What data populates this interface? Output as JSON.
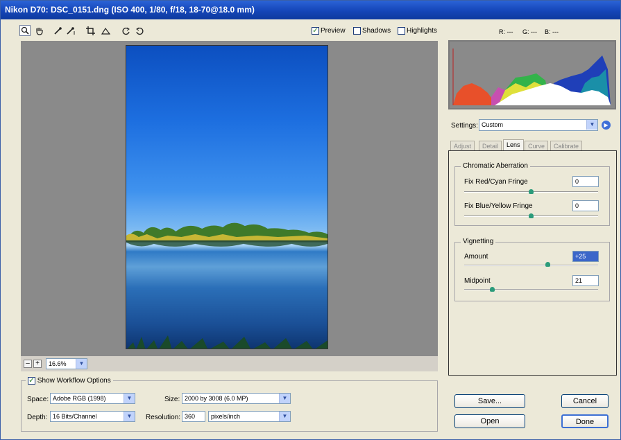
{
  "window": {
    "title": "Nikon D70: DSC_0151.dng  (ISO 400, 1/80, f/18, 18-70@18.0 mm)"
  },
  "toolbar": {
    "tools": [
      "zoom-tool",
      "hand-tool",
      "white-balance-tool",
      "color-sampler-tool",
      "crop-tool",
      "straighten-tool",
      "rotate-left",
      "rotate-right"
    ],
    "preview_label": "Preview",
    "preview_checked": true,
    "shadows_label": "Shadows",
    "shadows_checked": false,
    "highlights_label": "Highlights",
    "highlights_checked": false
  },
  "rgb_readout": {
    "r": "R: ---",
    "g": "G: ---",
    "b": "B: ---"
  },
  "zoom": {
    "minus": "–",
    "plus": "+",
    "value": "16.6%"
  },
  "settings": {
    "label": "Settings:",
    "value": "Custom"
  },
  "tabs": [
    {
      "label": "Adjust",
      "active": false
    },
    {
      "label": "Detail",
      "active": false
    },
    {
      "label": "Lens",
      "active": true
    },
    {
      "label": "Curve",
      "active": false
    },
    {
      "label": "Calibrate",
      "active": false
    }
  ],
  "chromatic": {
    "title": "Chromatic Aberration",
    "red_cyan_label": "Fix Red/Cyan Fringe",
    "red_cyan_value": "0",
    "blue_yellow_label": "Fix Blue/Yellow Fringe",
    "blue_yellow_value": "0"
  },
  "vignetting": {
    "title": "Vignetting",
    "amount_label": "Amount",
    "amount_value": "+25",
    "midpoint_label": "Midpoint",
    "midpoint_value": "21"
  },
  "workflow": {
    "show_label": "Show Workflow Options",
    "show_checked": true,
    "space_label": "Space:",
    "space_value": "Adobe RGB (1998)",
    "depth_label": "Depth:",
    "depth_value": "16 Bits/Channel",
    "size_label": "Size:",
    "size_value": "2000 by 3008  (6.0 MP)",
    "resolution_label": "Resolution:",
    "resolution_value": "360",
    "resolution_unit": "pixels/inch"
  },
  "buttons": {
    "save": "Save...",
    "open": "Open",
    "cancel": "Cancel",
    "done": "Done"
  },
  "colors": {
    "titlebar": "#1546b8",
    "thumb": "#2b9b7a",
    "accent": "#3c6fd4"
  }
}
